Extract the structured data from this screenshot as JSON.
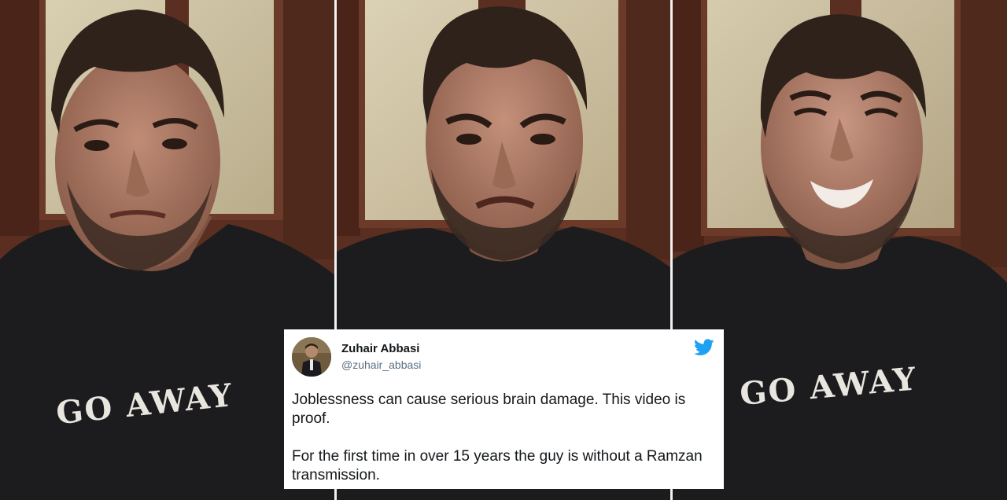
{
  "image": {
    "panels": [
      {
        "shirt_text": "GO AWAY"
      },
      {
        "shirt_text": ""
      },
      {
        "shirt_text": "GO AWAY"
      }
    ]
  },
  "tweet": {
    "display_name": "Zuhair Abbasi",
    "handle": "@zuhair_abbasi",
    "paragraphs": [
      "Joblessness can cause serious brain damage. This video is proof.",
      "For the first time in over 15 years the guy is without a Ramzan transmission."
    ],
    "icons": {
      "avatar": "user-avatar",
      "brand": "twitter-bird-icon"
    },
    "colors": {
      "brand": "#1da1f2",
      "handle": "#5b7083",
      "text": "#14171a"
    }
  }
}
